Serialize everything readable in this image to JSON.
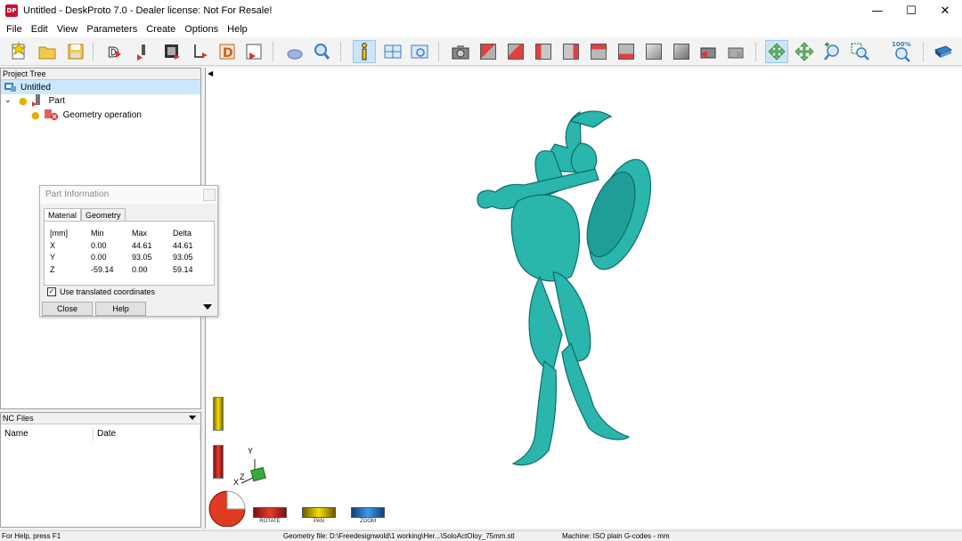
{
  "window": {
    "app_icon_text": "DP",
    "title": "Untitled - DeskProto 7.0 - Dealer license: Not For Resale!",
    "minimize": "—",
    "maximize": "☐",
    "close": "✕"
  },
  "menu": [
    "File",
    "Edit",
    "View",
    "Parameters",
    "Create",
    "Options",
    "Help"
  ],
  "toolbar": {
    "zoom_percent_label": "100%"
  },
  "project_tree": {
    "header": "Project Tree",
    "root": "Untitled",
    "part": "Part",
    "operation": "Geometry operation"
  },
  "nc_files": {
    "header": "NC Files",
    "col_name": "Name",
    "col_date": "Date"
  },
  "part_info": {
    "title": "Part Information",
    "tabs": [
      "Material",
      "Geometry"
    ],
    "headers": [
      "[mm]",
      "Min",
      "Max",
      "Delta"
    ],
    "rows": [
      {
        "axis": "X",
        "min": "0.00",
        "max": "44.61",
        "delta": "44.61"
      },
      {
        "axis": "Y",
        "min": "0.00",
        "max": "93.05",
        "delta": "93.05"
      },
      {
        "axis": "Z",
        "min": "-59.14",
        "max": "0.00",
        "delta": "59.14"
      }
    ],
    "checkbox_label": "Use translated coordinates",
    "checkbox_checked": true,
    "close_label": "Close",
    "help_label": "Help"
  },
  "viewport": {
    "toggle_glyph": "◀",
    "axis_x": "X",
    "axis_y": "Y",
    "axis_z": "Z",
    "model_color": "#2ab5ad",
    "modes": [
      "ROTATE",
      "PAN",
      "ZOOM"
    ]
  },
  "status": {
    "help": "For Help, press F1",
    "geometry": "Geometry file: D:\\Freedesignwold\\1 working\\Her...\\SoloActOloy_75mm.stl",
    "machine": "Machine: ISO plain G-codes - mm"
  }
}
